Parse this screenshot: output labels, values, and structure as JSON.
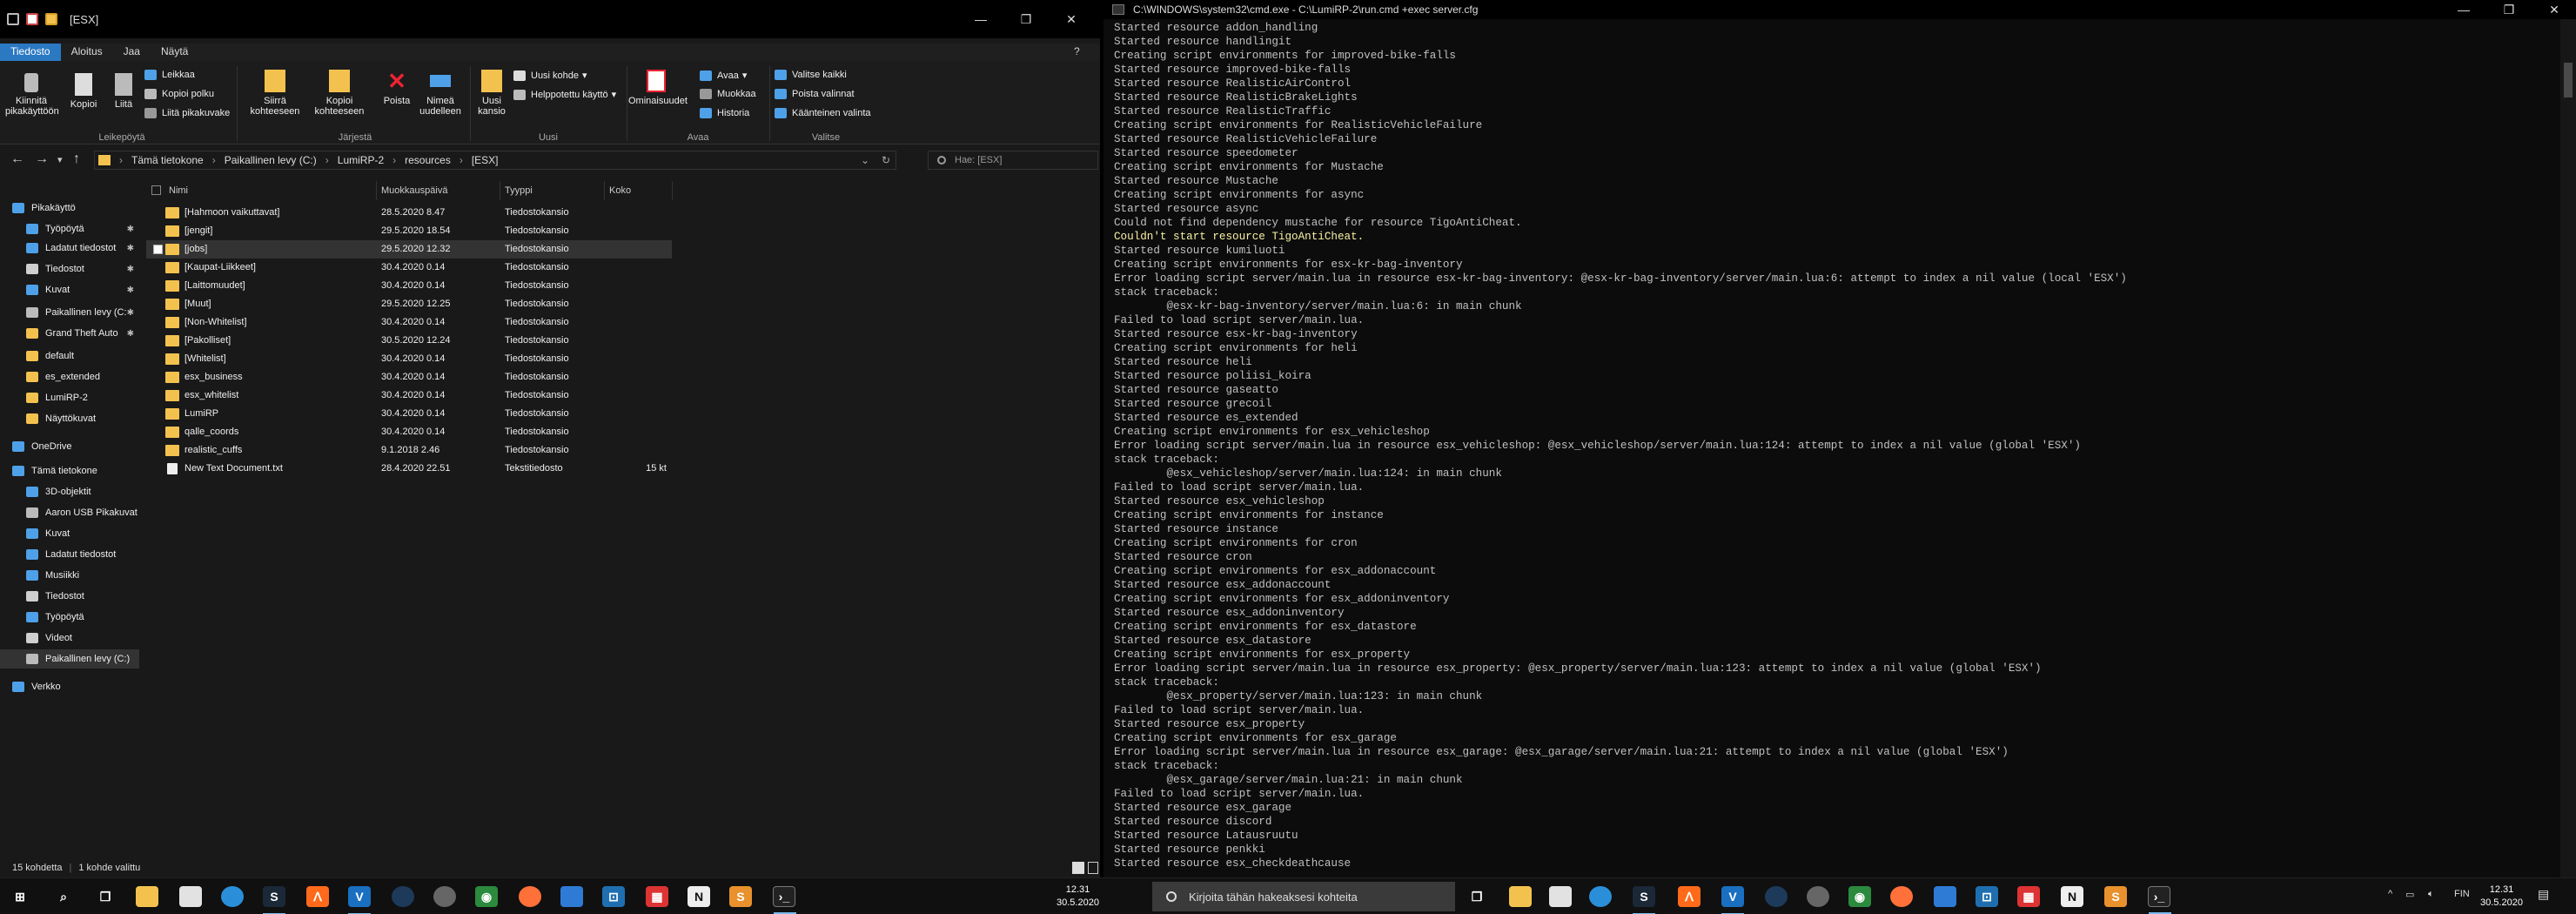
{
  "explorer": {
    "title": "[ESX]",
    "tabs": [
      "Tiedosto",
      "Aloitus",
      "Jaa",
      "Näytä"
    ],
    "ribbon": {
      "pin": "Kiinnitä pikakäyttöön",
      "copy": "Kopioi",
      "paste": "Liitä",
      "cut": "Leikkaa",
      "copy_path": "Kopioi polku",
      "paste_shortcut": "Liitä pikakuvake",
      "move_to": "Siirrä kohteeseen",
      "copy_to": "Kopioi kohteeseen",
      "delete": "Poista",
      "rename": "Nimeä uudelleen",
      "new_folder": "Uusi kansio",
      "new_item": "Uusi kohde",
      "easy_access": "Helppotettu käyttö",
      "properties": "Ominaisuudet",
      "open": "Avaa",
      "edit": "Muokkaa",
      "history": "Historia",
      "select_all": "Valitse kaikki",
      "select_none": "Poista valinnat",
      "invert": "Käänteinen valinta",
      "groups": [
        "Leikepöytä",
        "Järjestä",
        "Uusi",
        "Avaa",
        "Valitse"
      ]
    },
    "breadcrumb": [
      "Tämä tietokone",
      "Paikallinen levy (C:)",
      "LumiRP-2",
      "resources",
      "[ESX]"
    ],
    "search_placeholder": "Hae: [ESX]",
    "nav": [
      {
        "label": "Pikakäyttö",
        "color": "#4ea1e8"
      },
      {
        "label": "Työpöytä",
        "color": "#4ea1e8",
        "pin": "✱"
      },
      {
        "label": "Ladatut tiedostot",
        "color": "#4ea1e8",
        "pin": "✱"
      },
      {
        "label": "Tiedostot",
        "color": "#cfcfcf",
        "pin": "✱"
      },
      {
        "label": "Kuvat",
        "color": "#4ea1e8",
        "pin": "✱"
      },
      {
        "label": "Paikallinen levy (C:",
        "color": "#bbbbbb",
        "pin": "✱"
      },
      {
        "label": "Grand Theft Auto",
        "color": "#f3c24e",
        "pin": "✱"
      },
      {
        "label": "default",
        "color": "#f3c24e"
      },
      {
        "label": "es_extended",
        "color": "#f3c24e"
      },
      {
        "label": "LumiRP-2",
        "color": "#f3c24e"
      },
      {
        "label": "Näyttökuvat",
        "color": "#f3c24e"
      },
      {
        "label": "OneDrive",
        "color": "#4ea1e8"
      },
      {
        "label": "Tämä tietokone",
        "color": "#4ea1e8"
      },
      {
        "label": "3D-objektit",
        "color": "#4ea1e8"
      },
      {
        "label": "Aaron USB Pikakuvat",
        "color": "#bbbbbb"
      },
      {
        "label": "Kuvat",
        "color": "#4ea1e8"
      },
      {
        "label": "Ladatut tiedostot",
        "color": "#4ea1e8"
      },
      {
        "label": "Musiikki",
        "color": "#4ea1e8"
      },
      {
        "label": "Tiedostot",
        "color": "#cfcfcf"
      },
      {
        "label": "Työpöytä",
        "color": "#4ea1e8"
      },
      {
        "label": "Videot",
        "color": "#cfcfcf"
      },
      {
        "label": "Paikallinen levy (C:)",
        "color": "#bbbbbb",
        "selected": true
      },
      {
        "label": "Verkko",
        "color": "#4ea1e8"
      }
    ],
    "columns": {
      "name": "Nimi",
      "modified": "Muokkauspäivä",
      "type": "Tyyppi",
      "size": "Koko"
    },
    "files": [
      {
        "name": "[Hahmoon vaikuttavat]",
        "date": "28.5.2020 8.47",
        "type": "Tiedostokansio",
        "size": ""
      },
      {
        "name": "[jengit]",
        "date": "29.5.2020 18.54",
        "type": "Tiedostokansio",
        "size": ""
      },
      {
        "name": "[jobs]",
        "date": "29.5.2020 12.32",
        "type": "Tiedostokansio",
        "size": "",
        "selected": true
      },
      {
        "name": "[Kaupat-Liikkeet]",
        "date": "30.4.2020 0.14",
        "type": "Tiedostokansio",
        "size": ""
      },
      {
        "name": "[Laittomuudet]",
        "date": "30.4.2020 0.14",
        "type": "Tiedostokansio",
        "size": ""
      },
      {
        "name": "[Muut]",
        "date": "29.5.2020 12.25",
        "type": "Tiedostokansio",
        "size": ""
      },
      {
        "name": "[Non-Whitelist]",
        "date": "30.4.2020 0.14",
        "type": "Tiedostokansio",
        "size": ""
      },
      {
        "name": "[Pakolliset]",
        "date": "30.5.2020 12.24",
        "type": "Tiedostokansio",
        "size": ""
      },
      {
        "name": "[Whitelist]",
        "date": "30.4.2020 0.14",
        "type": "Tiedostokansio",
        "size": ""
      },
      {
        "name": "esx_business",
        "date": "30.4.2020 0.14",
        "type": "Tiedostokansio",
        "size": ""
      },
      {
        "name": "esx_whitelist",
        "date": "30.4.2020 0.14",
        "type": "Tiedostokansio",
        "size": ""
      },
      {
        "name": "LumiRP",
        "date": "30.4.2020 0.14",
        "type": "Tiedostokansio",
        "size": ""
      },
      {
        "name": "qalle_coords",
        "date": "30.4.2020 0.14",
        "type": "Tiedostokansio",
        "size": ""
      },
      {
        "name": "realistic_cuffs",
        "date": "9.1.2018 2.46",
        "type": "Tiedostokansio",
        "size": ""
      },
      {
        "name": "New Text Document.txt",
        "date": "28.4.2020 22.51",
        "type": "Tekstitiedosto",
        "size": "15 kt",
        "file": true
      }
    ],
    "status": {
      "count": "15 kohdetta",
      "selected": "1 kohde valittu"
    }
  },
  "cmd": {
    "title": "C:\\WINDOWS\\system32\\cmd.exe - C:\\LumiRP-2\\run.cmd  +exec server.cfg",
    "lines": [
      "Started resource addon_handling",
      "Started resource handlingit",
      "Creating script environments for improved-bike-falls",
      "Started resource improved-bike-falls",
      "Started resource RealisticAirControl",
      "Started resource RealisticBrakeLights",
      "Started resource RealisticTraffic",
      "Creating script environments for RealisticVehicleFailure",
      "Started resource RealisticVehicleFailure",
      "Started resource speedometer",
      "Creating script environments for Mustache",
      "Started resource Mustache",
      "Creating script environments for async",
      "Started resource async",
      "Could not find dependency mustache for resource TigoAntiCheat.",
      "Couldn't start resource TigoAntiCheat.",
      "Started resource kumiluoti",
      "Creating script environments for esx-kr-bag-inventory",
      "Error loading script server/main.lua in resource esx-kr-bag-inventory: @esx-kr-bag-inventory/server/main.lua:6: attempt to index a nil value (local 'ESX')",
      "stack traceback:",
      "        @esx-kr-bag-inventory/server/main.lua:6: in main chunk",
      "Failed to load script server/main.lua.",
      "Started resource esx-kr-bag-inventory",
      "Creating script environments for heli",
      "Started resource heli",
      "Started resource poliisi_koira",
      "Started resource gaseatto",
      "Started resource grecoil",
      "Started resource es_extended",
      "Creating script environments for esx_vehicleshop",
      "Error loading script server/main.lua in resource esx_vehicleshop: @esx_vehicleshop/server/main.lua:124: attempt to index a nil value (global 'ESX')",
      "stack traceback:",
      "        @esx_vehicleshop/server/main.lua:124: in main chunk",
      "Failed to load script server/main.lua.",
      "Started resource esx_vehicleshop",
      "Creating script environments for instance",
      "Started resource instance",
      "Creating script environments for cron",
      "Started resource cron",
      "Creating script environments for esx_addonaccount",
      "Started resource esx_addonaccount",
      "Creating script environments for esx_addoninventory",
      "Started resource esx_addoninventory",
      "Creating script environments for esx_datastore",
      "Started resource esx_datastore",
      "Creating script environments for esx_property",
      "Error loading script server/main.lua in resource esx_property: @esx_property/server/main.lua:123: attempt to index a nil value (global 'ESX')",
      "stack traceback:",
      "        @esx_property/server/main.lua:123: in main chunk",
      "Failed to load script server/main.lua.",
      "Started resource esx_property",
      "Creating script environments for esx_garage",
      "Error loading script server/main.lua in resource esx_garage: @esx_garage/server/main.lua:21: attempt to index a nil value (global 'ESX')",
      "stack traceback:",
      "        @esx_garage/server/main.lua:21: in main chunk",
      "Failed to load script server/main.lua.",
      "Started resource esx_garage",
      "Started resource discord",
      "Started resource Latausruutu",
      "Started resource penkki",
      "Started resource esx_checkdeathcause"
    ],
    "highlight_lines": [
      15
    ]
  },
  "taskbar": {
    "search_placeholder": "Kirjoita tähän hakeaksesi kohteita",
    "left_clock_time": "12.31",
    "left_clock_date": "30.5.2020",
    "right_clock_time": "12.31",
    "right_clock_date": "30.5.2020",
    "lang": "FIN",
    "tray_arrow": "^"
  },
  "colors": {
    "accent": "#2b79c2",
    "folder": "#f3c24e",
    "console_bg": "#0c0c0c",
    "console_fg": "#c0c0c0",
    "console_warn": "#f9f1a5"
  }
}
